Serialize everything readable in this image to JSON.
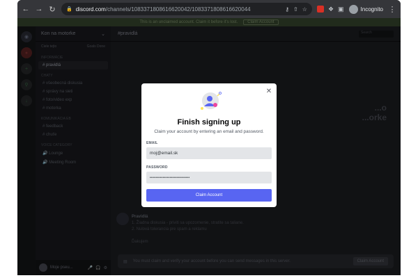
{
  "browser": {
    "url_host": "discord.com",
    "url_path": "/channels/1083371808616620042/1083371808616620044",
    "profile_label": "Incognito"
  },
  "notice": {
    "text": "This is an unclaimed account. Claim it before it's lost.",
    "button_label": "Claim Account"
  },
  "server": {
    "name": "Kon na motorke",
    "boost_left": "Ciele tejto",
    "boost_right": "Goals Done"
  },
  "channels": {
    "categories": [
      "INFORMÁCIE",
      "CHATY",
      "KOMUNIKÁCIA EB",
      "VOICE CATEGORY"
    ],
    "items": [
      {
        "name": "pravidlá",
        "active": true
      },
      {
        "name": "všeobecná diskusia",
        "active": false
      },
      {
        "name": "správy na sieti",
        "active": false
      },
      {
        "name": "foto/video exp",
        "active": false
      },
      {
        "name": "motorka",
        "active": false
      },
      {
        "name": "feedback",
        "active": false
      },
      {
        "name": "chuťe",
        "active": false
      },
      {
        "name": "Lounge",
        "active": false
      },
      {
        "name": "Meeting Room",
        "active": false
      }
    ]
  },
  "user": {
    "name": "Moje pseu...",
    "status": "#1..."
  },
  "main": {
    "channel_title": "pravidlá",
    "search_placeholder": "Search",
    "welcome_line1": "...o",
    "welcome_line2": "...orke",
    "message_title": "Pravidlá",
    "message_lines": [
      "1. Žiadna diskusia - priviti sa upozornenie, stratite sa taliane.",
      "2. Nulová tolerancia pre spam a reklamu",
      "Ďakujem"
    ],
    "composer_text": "You must claim and verify your account before you can send messages in this server.",
    "composer_button": "Claim Account"
  },
  "modal": {
    "title": "Finish signing up",
    "subtitle": "Claim your account by entering an email and password.",
    "email_label": "EMAIL",
    "email_value": "moj@email.sk",
    "password_label": "PASSWORD",
    "password_value": "••••••••••••••••••••••••••••",
    "button_label": "Claim Account"
  },
  "colors": {
    "blurple": "#5865f2",
    "modal_bg": "#ffffff",
    "input_bg": "#e3e5e8"
  }
}
